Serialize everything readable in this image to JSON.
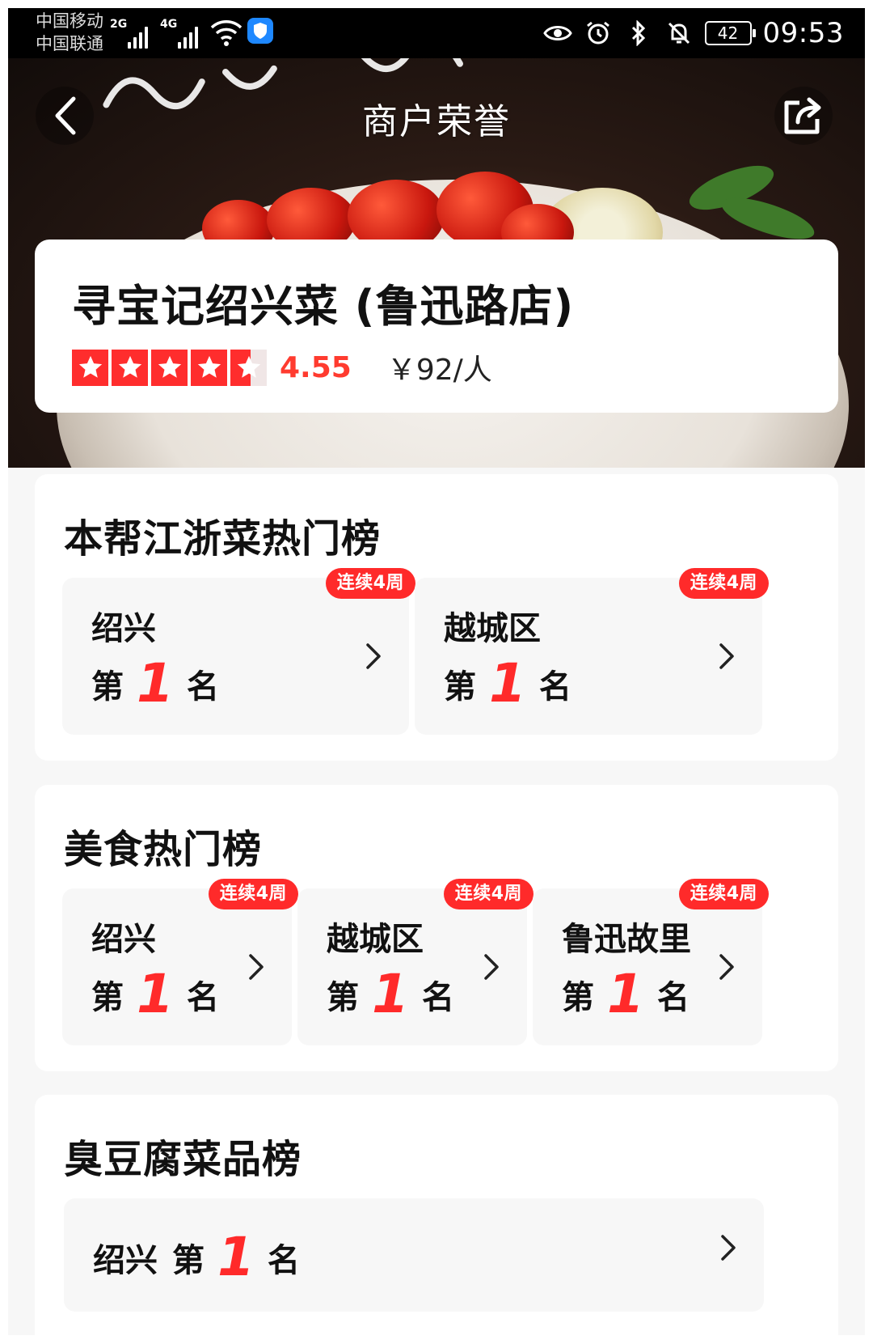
{
  "status_bar": {
    "carrier_1": "中国移动",
    "carrier_2": "中国联通",
    "sim1_network": "2G",
    "sim2_network": "4G",
    "battery": "42",
    "time": "09:53"
  },
  "hero": {
    "title": "商户荣誉",
    "back_icon": "chevron-left-icon",
    "share_icon": "share-icon"
  },
  "shop": {
    "name": "寻宝记绍兴菜 (鲁迅路店)",
    "rating": 4.55,
    "rating_text": "4.55",
    "price": "￥92/人",
    "colors": {
      "accent": "#ff2d2d"
    }
  },
  "sections": [
    {
      "title": "本帮江浙菜热门榜",
      "items": [
        {
          "area": "绍兴",
          "prefix": "第",
          "rank": "1",
          "suffix": "名",
          "badge": "连续4周"
        },
        {
          "area": "越城区",
          "prefix": "第",
          "rank": "1",
          "suffix": "名",
          "badge": "连续4周"
        }
      ]
    },
    {
      "title": "美食热门榜",
      "items": [
        {
          "area": "绍兴",
          "prefix": "第",
          "rank": "1",
          "suffix": "名",
          "badge": "连续4周"
        },
        {
          "area": "越城区",
          "prefix": "第",
          "rank": "1",
          "suffix": "名",
          "badge": "连续4周"
        },
        {
          "area": "鲁迅故里",
          "prefix": "第",
          "rank": "1",
          "suffix": "名",
          "badge": "连续4周"
        }
      ]
    },
    {
      "title": "臭豆腐菜品榜",
      "items": [
        {
          "area": "绍兴",
          "prefix": "第",
          "rank": "1",
          "suffix": "名"
        }
      ]
    }
  ]
}
